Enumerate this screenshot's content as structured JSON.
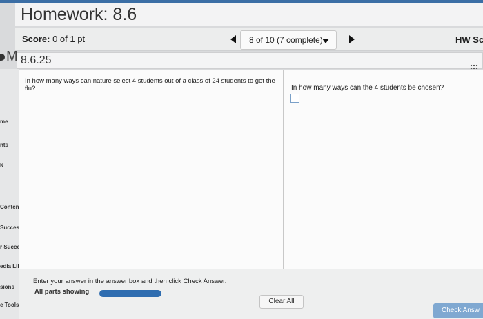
{
  "title": "Homework: 8.6",
  "score": {
    "label": "Score:",
    "value": "0 of 1 pt"
  },
  "nav": {
    "question_status": "8 of 10 (7 complete)"
  },
  "hw_label": "HW Sc",
  "left_fragment": "M",
  "question_id": "8.6.25",
  "sidebar": {
    "items": [
      {
        "label": "me"
      },
      {
        "label": "nts"
      },
      {
        "label": "k"
      },
      {
        "label": "Content"
      },
      {
        "label": "Success"
      },
      {
        "label": "r Success"
      },
      {
        "label": "edia Libra"
      },
      {
        "label": "sions"
      },
      {
        "label": "e Tools"
      }
    ]
  },
  "question": {
    "text": "In how many ways can nature select 4 students out of a class of 24 students to get the flu?",
    "prompt": "In how many ways can the 4 students be chosen?",
    "answer_value": ""
  },
  "footer": {
    "instruction": "Enter your answer in the answer box and then click Check Answer.",
    "parts": "All parts showing",
    "progress": 1.0,
    "clear_label": "Clear All",
    "check_label": "Check Answ"
  }
}
